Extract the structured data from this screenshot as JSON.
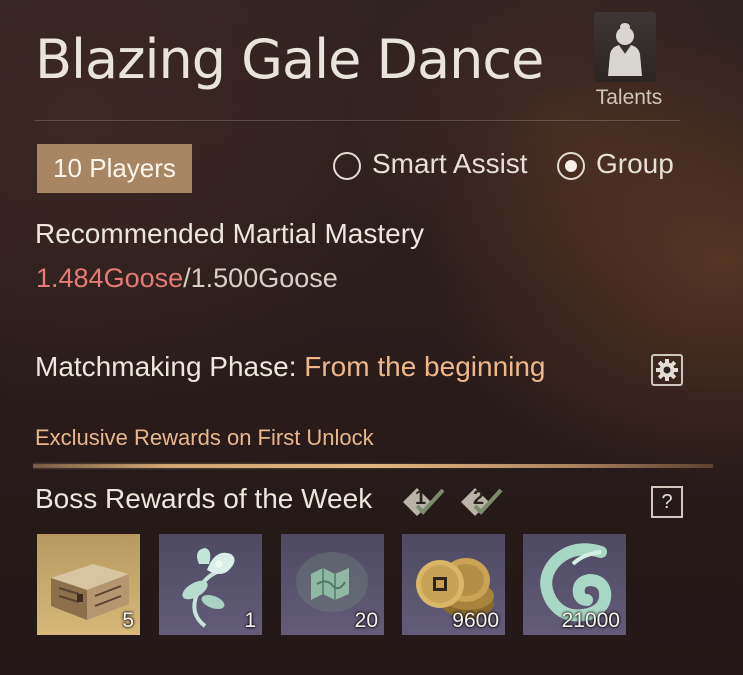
{
  "header": {
    "title": "Blazing Gale Dance",
    "talents_label": "Talents",
    "talents_icon": "character-silhouette-icon"
  },
  "mode": {
    "players_label": "10 Players",
    "options": [
      {
        "label": "Smart Assist",
        "selected": false
      },
      {
        "label": "Group",
        "selected": true
      }
    ]
  },
  "recommendation": {
    "label": "Recommended Martial Mastery",
    "current": "1.484Goose",
    "separator": "/",
    "required": "1.500Goose",
    "current_color": "#e57b73"
  },
  "matchmaking": {
    "label": "Matchmaking Phase",
    "colon": ": ",
    "value": "From the beginning",
    "settings_icon": "gear-icon"
  },
  "rewards": {
    "exclusive_label": "Exclusive Rewards on First Unlock",
    "boss_label": "Boss Rewards of the Week",
    "week_badges": [
      "1",
      "2"
    ],
    "help_label": "?",
    "items": [
      {
        "icon": "chest-icon",
        "quantity": "5"
      },
      {
        "icon": "flower-icon",
        "quantity": "1"
      },
      {
        "icon": "map-scroll-icon",
        "quantity": "20"
      },
      {
        "icon": "coins-icon",
        "quantity": "9600"
      },
      {
        "icon": "jade-wave-icon",
        "quantity": "21000"
      }
    ]
  },
  "colors": {
    "accent_gold": "#a88664",
    "highlight_orange": "#f0b88a",
    "warning_red": "#e57b73"
  }
}
